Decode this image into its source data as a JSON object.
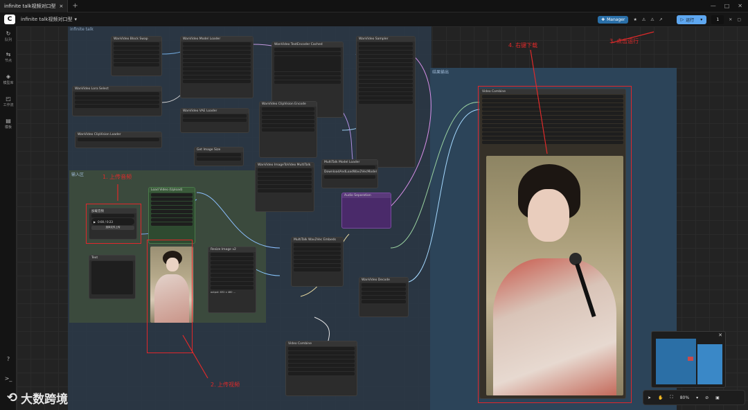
{
  "app": {
    "tab_title": "infinite talk视频对口型",
    "workflow_tab": "infinite talk视频对口型"
  },
  "toolbar": {
    "manager_label": "Manager",
    "run_label": "运行",
    "run_count": "1"
  },
  "sidebar": {
    "items": [
      {
        "icon": "queue-icon",
        "label": "队列"
      },
      {
        "icon": "nodes-icon",
        "label": "节点"
      },
      {
        "icon": "models-icon",
        "label": "模型库"
      },
      {
        "icon": "workflows-icon",
        "label": "工作流"
      },
      {
        "icon": "templates-icon",
        "label": "模板"
      },
      {
        "icon": "help-icon",
        "label": ""
      },
      {
        "icon": "terminal-icon",
        "label": ""
      }
    ]
  },
  "groups": {
    "main": "infinite talk",
    "upload": "输入区",
    "result": "结果输出"
  },
  "nodes": {
    "block_swap": "WanVideo Block Swap",
    "model_loader": "WanVideo Model Loader",
    "lora_select": "WanVideo Lora Select",
    "textencoder": "WanVideo TextEncoder Cached",
    "sampler": "WanVideo Sampler",
    "vae_loader": "WanVideo VAE Loader",
    "clip_loader": "WanVideo ClipVision Loader",
    "image_encode": "WanVideo ImageToVideo MultiTalk",
    "load_video": "Load Video (Upload)",
    "load_audio": "加载音频",
    "text": "Text",
    "resize_image": "Resize Image v2",
    "decode": "WanVideo Decode",
    "video_combine": "Video Combine",
    "multitalk_model": "MultiTalk Model Loader",
    "wav2vec": "DownloadAndLoadWav2VecModel",
    "audio_embeds": "MultiTalk Wav2Vec Embeds",
    "clip_encode": "WanVideo ClipVision Encode",
    "audio_separation": "Audio Separation",
    "get_image_size": "Get Image Size",
    "audio_player_time": "0:00 / 0:23",
    "upload_audio_btn": "选择文件上传",
    "resize_output": "output: 832 x 480 ..."
  },
  "annotations": {
    "step1": "1. 上传音频",
    "step2": "2. 上传视频",
    "step3": "3. 点击运行",
    "step4": "4. 右键下载"
  },
  "zoom": "80%",
  "watermark": "大数跨境",
  "colors": {
    "annotation": "#e02a2a",
    "run_button": "#5ea7f0",
    "manager": "#2a6fa8"
  }
}
